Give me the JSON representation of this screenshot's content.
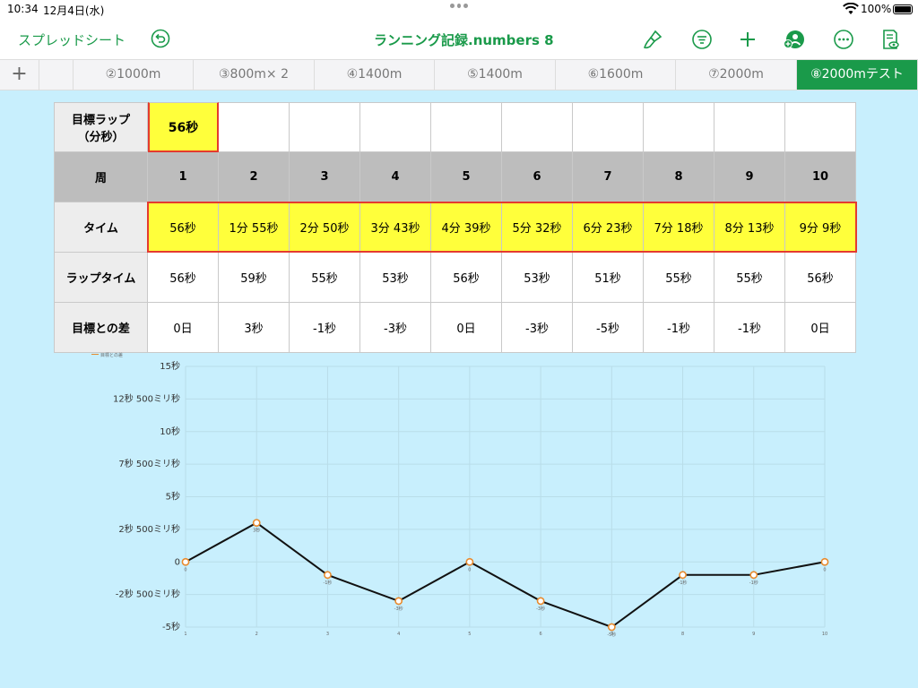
{
  "status": {
    "time": "10:34",
    "date": "12月4日(水)",
    "battery": "100%"
  },
  "toolbar": {
    "back_label": "スプレッドシート",
    "title": "ランニング記録.numbers 8",
    "icons": [
      "undo-icon",
      "brush-icon",
      "filter-icon",
      "plus-icon",
      "collaborate-icon",
      "more-icon",
      "document-view-icon"
    ]
  },
  "tabs": {
    "add_icon": "+",
    "items": [
      {
        "label": ""
      },
      {
        "label": "②1000m"
      },
      {
        "label": "③800m× 2"
      },
      {
        "label": "④1400m"
      },
      {
        "label": "⑤1400m"
      },
      {
        "label": "⑥1600m"
      },
      {
        "label": "⑦2000m"
      },
      {
        "label": "⑧2000mテスト",
        "active": true
      }
    ]
  },
  "table": {
    "target": {
      "label": "目標ラップ\n（分秒）",
      "value": "56秒"
    },
    "rows": [
      {
        "label": "周",
        "values": [
          "1",
          "2",
          "3",
          "4",
          "5",
          "6",
          "7",
          "8",
          "9",
          "10"
        ]
      },
      {
        "label": "タイム",
        "values": [
          "56秒",
          "1分 55秒",
          "2分 50秒",
          "3分 43秒",
          "4分 39秒",
          "5分 32秒",
          "6分 23秒",
          "7分 18秒",
          "8分 13秒",
          "9分 9秒"
        ]
      },
      {
        "label": "ラップタイム",
        "values": [
          "56秒",
          "59秒",
          "55秒",
          "53秒",
          "56秒",
          "53秒",
          "51秒",
          "55秒",
          "55秒",
          "56秒"
        ]
      },
      {
        "label": "目標との差",
        "values": [
          "0日",
          "3秒",
          "-1秒",
          "-3秒",
          "0日",
          "-3秒",
          "-5秒",
          "-1秒",
          "-1秒",
          "0日"
        ]
      }
    ]
  },
  "colors": {
    "accent": "#1a9a4a",
    "highlight": "#ffff3b",
    "selection": "#e43a2f",
    "background": "#c8effd",
    "line": "#111111",
    "marker": "#e88a2d"
  },
  "chart_data": {
    "type": "line",
    "title": "",
    "legend": "目標との差",
    "legend_position": "top-left",
    "x": [
      1,
      2,
      3,
      4,
      5,
      6,
      7,
      8,
      9,
      10
    ],
    "series": [
      {
        "name": "目標との差",
        "values": [
          0,
          3,
          -1,
          -3,
          0,
          -3,
          -5,
          -1,
          -1,
          0
        ]
      }
    ],
    "point_labels": [
      "0",
      "3秒",
      "-1秒",
      "-3秒",
      "0",
      "-3秒",
      "-5秒",
      "-1秒",
      "-1秒",
      "0"
    ],
    "y_ticks": [
      {
        "value": 15,
        "label": "15秒"
      },
      {
        "value": 12.5,
        "label": "12秒 500ミリ秒"
      },
      {
        "value": 10,
        "label": "10秒"
      },
      {
        "value": 7.5,
        "label": "7秒 500ミリ秒"
      },
      {
        "value": 5,
        "label": "5秒"
      },
      {
        "value": 2.5,
        "label": "2秒 500ミリ秒"
      },
      {
        "value": 0,
        "label": "0"
      },
      {
        "value": -2.5,
        "label": "-2秒 500ミリ秒"
      },
      {
        "value": -5,
        "label": "-5秒"
      }
    ],
    "ylim": [
      -5,
      15
    ],
    "grid": true
  }
}
